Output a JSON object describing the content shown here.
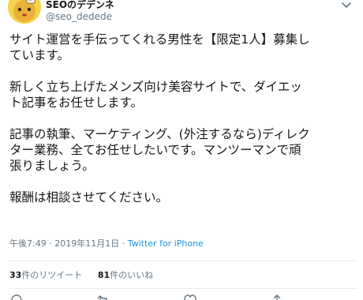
{
  "author": {
    "display_name": "SEOのデデンネ",
    "username": "@seo_dedede",
    "avatar_icon": "dedenne-avatar-icon"
  },
  "tweet": {
    "paragraphs": [
      "サイト運営を手伝ってくれる男性を【限定1人】募集し\nています。",
      "新しく立ち上げたメンズ向け美容サイトで、ダイエッ\nト記事をお任せします。",
      "記事の執筆、マーケティング、(外注するなら)ディレク\nター業務、全てお任せしたいです。マンツーマンで頑\n張りましょう。",
      "報酬は相談させてください。"
    ]
  },
  "meta": {
    "time": "午後7:49",
    "separator": " · ",
    "date": "2019年11月1日",
    "client": "Twitter for iPhone"
  },
  "stats": {
    "retweets_count": "33",
    "retweets_label": "件のリツイート",
    "likes_count": "81",
    "likes_label": "件のいいね"
  },
  "colors": {
    "text": "#14171a",
    "muted": "#657786",
    "link": "#1b95e0",
    "divider": "#e6ecf0"
  }
}
